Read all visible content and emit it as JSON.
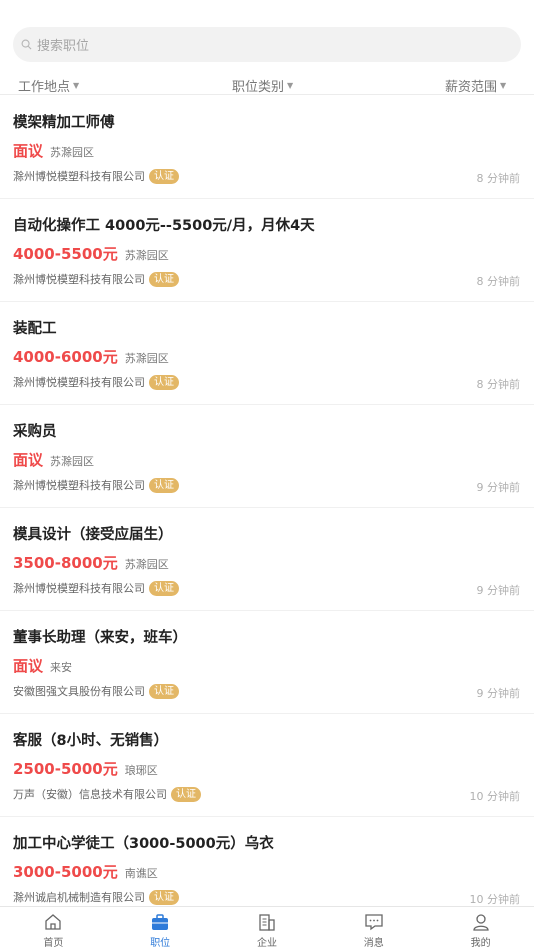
{
  "search": {
    "placeholder": "搜索职位"
  },
  "filters": [
    {
      "label": "工作地点"
    },
    {
      "label": "职位类别"
    },
    {
      "label": "薪资范围"
    }
  ],
  "badge_label": "认证",
  "jobs": [
    {
      "title": "模架精加工师傅",
      "salary": "面议",
      "location": "苏滁园区",
      "company": "滁州博悦模塑科技有限公司",
      "time": "8 分钟前"
    },
    {
      "title": "自动化操作工 4000元--5500元/月，月休4天",
      "salary": "4000-5500元",
      "location": "苏滁园区",
      "company": "滁州博悦模塑科技有限公司",
      "time": "8 分钟前"
    },
    {
      "title": "装配工",
      "salary": "4000-6000元",
      "location": "苏滁园区",
      "company": "滁州博悦模塑科技有限公司",
      "time": "8 分钟前"
    },
    {
      "title": "采购员",
      "salary": "面议",
      "location": "苏滁园区",
      "company": "滁州博悦模塑科技有限公司",
      "time": "9 分钟前"
    },
    {
      "title": "模具设计（接受应届生）",
      "salary": "3500-8000元",
      "location": "苏滁园区",
      "company": "滁州博悦模塑科技有限公司",
      "time": "9 分钟前"
    },
    {
      "title": "董事长助理（来安，班车）",
      "salary": "面议",
      "location": "来安",
      "company": "安徽图强文具股份有限公司",
      "time": "9 分钟前"
    },
    {
      "title": "客服（8小时、无销售）",
      "salary": "2500-5000元",
      "location": "琅琊区",
      "company": "万声（安徽）信息技术有限公司",
      "time": "10 分钟前"
    },
    {
      "title": "加工中心学徒工（3000-5000元）乌衣",
      "salary": "3000-5000元",
      "location": "南谯区",
      "company": "滁州诚启机械制造有限公司",
      "time": "10 分钟前"
    }
  ],
  "tabbar": {
    "active_color": "#2f7bd9",
    "items": [
      {
        "label": "首页",
        "icon": "home-icon"
      },
      {
        "label": "职位",
        "icon": "briefcase-icon"
      },
      {
        "label": "企业",
        "icon": "building-icon"
      },
      {
        "label": "消息",
        "icon": "message-icon"
      },
      {
        "label": "我的",
        "icon": "user-icon"
      }
    ]
  }
}
